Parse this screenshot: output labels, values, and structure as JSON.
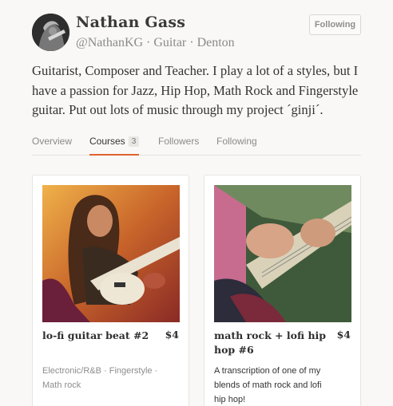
{
  "profile": {
    "name": "Nathan Gass",
    "handle": "@NathanKG",
    "instrument": "Guitar",
    "location": "Denton",
    "meta_separator": " · ",
    "follow_label": "Following",
    "bio": "Guitarist, Composer and Teacher. I play a lot of a styles, but I have a passion for Jazz, Hip Hop, Math Rock and Fingerstyle guitar. Put out lots of music through my project ´ginji´."
  },
  "tabs": [
    {
      "label": "Overview"
    },
    {
      "label": "Courses",
      "count": "3"
    },
    {
      "label": "Followers"
    },
    {
      "label": "Following"
    }
  ],
  "courses": [
    {
      "title": "lo-fi guitar beat #2",
      "price": "$4",
      "tags": "Electronic/R&B · Fingerstyle · Math rock",
      "image_icon": "guitarist-photo"
    },
    {
      "title": "math rock + lofi hip hop #6",
      "price": "$4",
      "description": "A transcription of one of my blends of math rock and lofi hip hop!",
      "image_icon": "guitar-closeup-photo"
    }
  ],
  "colors": {
    "accent": "#e0632f",
    "background": "#f9f8f6"
  }
}
